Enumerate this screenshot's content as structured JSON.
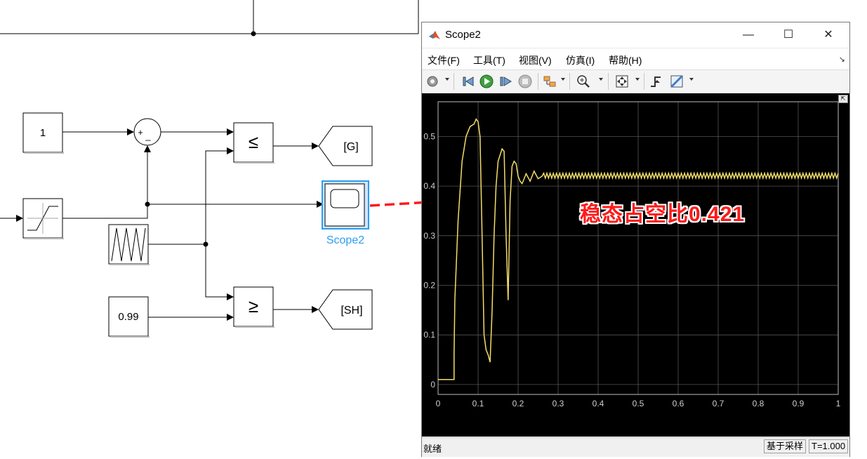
{
  "model": {
    "constant_1": "1",
    "sum_signs": [
      "+",
      "_"
    ],
    "relop_le": "≤",
    "relop_ge": "≥",
    "goto_g": "[G]",
    "goto_sh": "[SH]",
    "constant_099": "0.99",
    "scope_label": "Scope2"
  },
  "window": {
    "title": "Scope2",
    "buttons": {
      "minimize": "—",
      "maximize": "☐",
      "close": "✕"
    }
  },
  "menu": {
    "items": [
      "文件(F)",
      "工具(T)",
      "视图(V)",
      "仿真(I)",
      "帮助(H)"
    ],
    "collapse": "↘"
  },
  "toolbar": {
    "icons": [
      "settings-icon",
      "step-back-icon",
      "run-icon",
      "step-forward-icon",
      "stop-icon",
      "highlight-block-icon",
      "zoom-icon",
      "fit-to-view-icon",
      "trigger-icon",
      "measurements-icon"
    ]
  },
  "status": {
    "left": "就绪",
    "sample_mode": "基于采样",
    "time": "T=1.000"
  },
  "annotation": "稳态占空比0.421",
  "colors": {
    "trace": "#f2dc6a",
    "annotation": "#ff1a1a",
    "scope_selected": "#2b9ef0",
    "plot_bg": "#000000",
    "grid": "#555555",
    "arrow": "#ff1a1a"
  },
  "chart_data": {
    "type": "line",
    "xlim": [
      0,
      1
    ],
    "ylim": [
      -0.02,
      0.57
    ],
    "grid": true,
    "x_ticks": [
      "0",
      "0.1",
      "0.2",
      "0.3",
      "0.4",
      "0.5",
      "0.6",
      "0.7",
      "0.8",
      "0.9",
      "1"
    ],
    "y_ticks": [
      "0",
      "0.1",
      "0.2",
      "0.3",
      "0.4",
      "0.5"
    ],
    "x_tick_values": [
      0,
      0.1,
      0.2,
      0.3,
      0.4,
      0.5,
      0.6,
      0.7,
      0.8,
      0.9,
      1
    ],
    "y_tick_values": [
      0,
      0.1,
      0.2,
      0.3,
      0.4,
      0.5
    ],
    "series": [
      {
        "x": [
          0,
          0.04,
          0.04,
          0.042,
          0.05,
          0.06,
          0.07,
          0.08,
          0.09,
          0.095,
          0.1,
          0.105,
          0.11,
          0.115,
          0.12,
          0.125,
          0.13,
          0.135,
          0.14,
          0.145,
          0.15,
          0.16,
          0.165,
          0.17,
          0.175,
          0.18,
          0.185,
          0.19,
          0.195,
          0.2,
          0.205,
          0.21,
          0.215,
          0.22,
          0.23,
          0.24,
          0.25,
          0.26
        ],
        "y": [
          0.01,
          0.01,
          0.06,
          0.17,
          0.33,
          0.45,
          0.5,
          0.52,
          0.525,
          0.535,
          0.53,
          0.5,
          0.3,
          0.1,
          0.07,
          0.06,
          0.045,
          0.15,
          0.3,
          0.4,
          0.45,
          0.475,
          0.47,
          0.3,
          0.17,
          0.37,
          0.44,
          0.45,
          0.445,
          0.42,
          0.41,
          0.405,
          0.415,
          0.425,
          0.41,
          0.43,
          0.415,
          0.42
        ],
        "steady_value": 0.421,
        "steady_ripple": 0.005,
        "steady_start": 0.26
      }
    ]
  }
}
